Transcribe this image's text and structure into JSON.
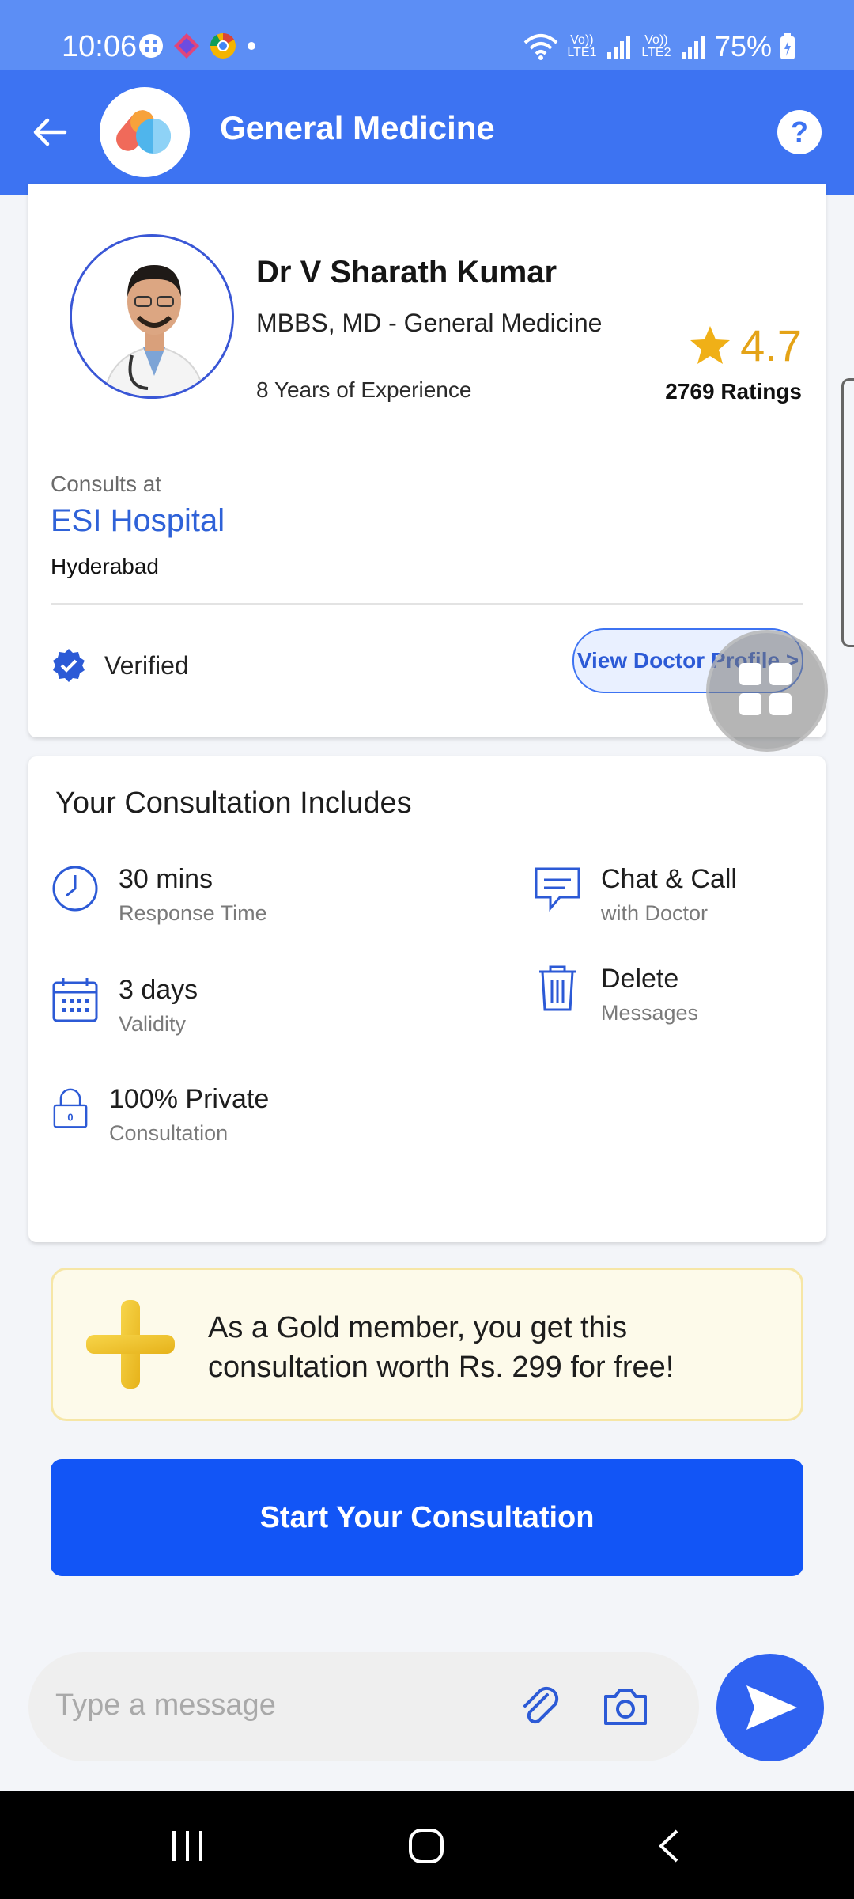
{
  "status_bar": {
    "time": "10:06",
    "signal1": "Vo)) LTE1",
    "signal2": "Vo)) LTE2",
    "battery": "75%"
  },
  "app_bar": {
    "title": "General Medicine",
    "help_label": "?"
  },
  "doctor": {
    "name": "Dr V Sharath Kumar",
    "qualifications": "MBBS, MD - General Medicine",
    "experience": "8 Years of Experience",
    "rating": "4.7",
    "ratings_count": "2769 Ratings",
    "consults_label": "Consults at",
    "hospital": "ESI Hospital",
    "city": "Hyderabad",
    "verified_label": "Verified",
    "profile_button": "View Doctor Profile >"
  },
  "includes": {
    "title": "Your Consultation Includes",
    "features": [
      {
        "title": "30 mins",
        "subtitle": "Response Time",
        "icon": "clock-icon"
      },
      {
        "title": "Chat & Call",
        "subtitle": "with Doctor",
        "icon": "chat-icon"
      },
      {
        "title": "3 days",
        "subtitle": "Validity",
        "icon": "calendar-icon"
      },
      {
        "title": "Delete",
        "subtitle": "Messages",
        "icon": "trash-icon"
      },
      {
        "title": "100% Private",
        "subtitle": "Consultation",
        "icon": "lock-icon"
      }
    ]
  },
  "gold_banner": {
    "line1": "As a Gold member, you get this",
    "line2": "consultation worth Rs. 299 for free!"
  },
  "start_button": "Start Your Consultation",
  "message": {
    "placeholder": "Type a message"
  },
  "colors": {
    "primary": "#3d73f2",
    "button": "#1255f6",
    "star": "#e4a317",
    "hospital_link": "#2f62d8"
  }
}
